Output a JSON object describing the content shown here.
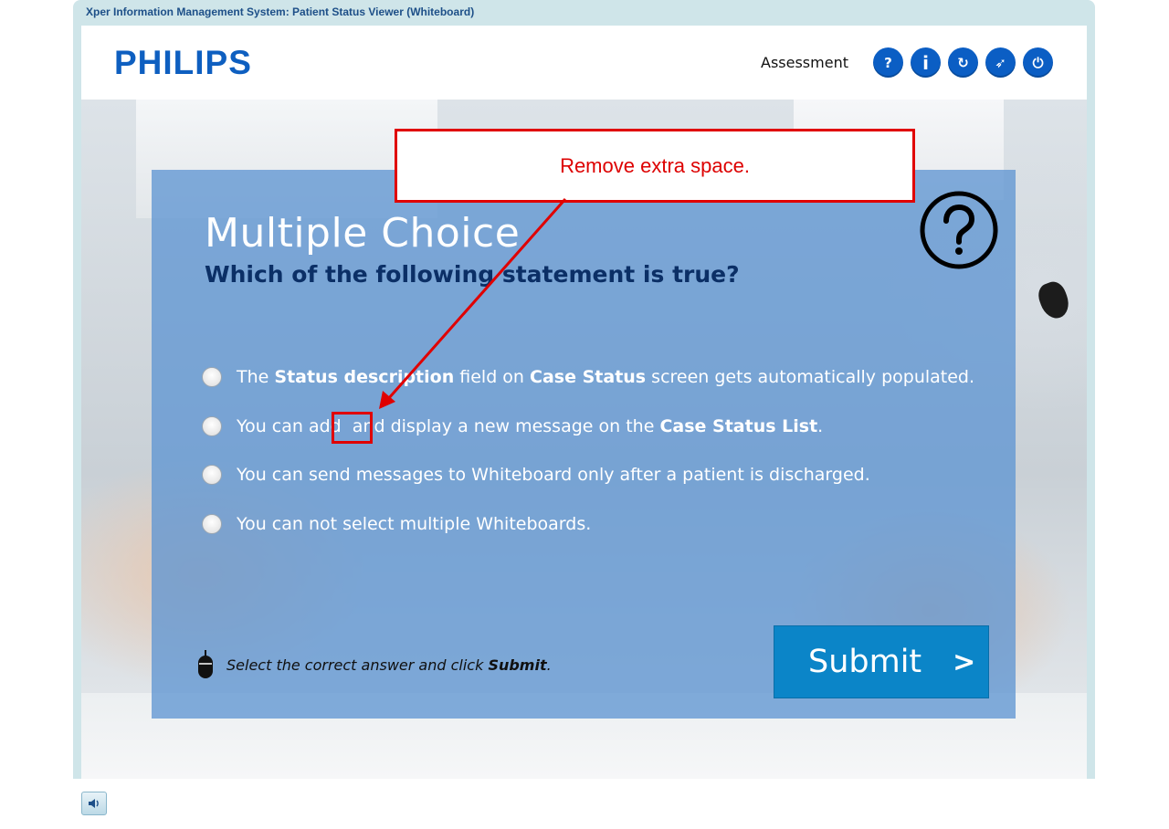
{
  "window": {
    "title": "Xper Information Management System: Patient Status Viewer (Whiteboard)"
  },
  "header": {
    "logo_text": "PHILIPS",
    "section_label": "Assessment",
    "buttons": [
      {
        "name": "help-button",
        "glyph": "?"
      },
      {
        "name": "info-button",
        "glyph": "i"
      },
      {
        "name": "replay-button",
        "glyph": "↻"
      },
      {
        "name": "navigate-button",
        "glyph": "➶"
      },
      {
        "name": "exit-button",
        "glyph": "⏻"
      }
    ]
  },
  "question": {
    "title": "Multiple Choice",
    "prompt": "Which of the following statement is true?",
    "options": [
      {
        "parts": [
          {
            "t": "The "
          },
          {
            "t": "Status description",
            "b": true
          },
          {
            "t": " field on "
          },
          {
            "t": "Case Status",
            "b": true
          },
          {
            "t": " screen gets automatically populated."
          }
        ]
      },
      {
        "parts": [
          {
            "t": "You can add  and display a new message on the "
          },
          {
            "t": "Case Status List",
            "b": true
          },
          {
            "t": "."
          }
        ]
      },
      {
        "parts": [
          {
            "t": "You can send messages to Whiteboard only after a patient is discharged."
          }
        ]
      },
      {
        "parts": [
          {
            "t": "You can not select multiple Whiteboards."
          }
        ]
      }
    ],
    "instruction_prefix": "Select the correct answer and click ",
    "instruction_bold": "Submit",
    "instruction_suffix": ".",
    "submit_label": "Submit",
    "submit_chevron": ">"
  },
  "annotation": {
    "callout_text": "Remove extra space."
  },
  "colors": {
    "accent": "#0b5ec4",
    "panel": "#6096d2",
    "submit": "#0b85c8",
    "annotation": "#e00000",
    "prompt": "#0b2f66"
  },
  "icons": [
    "help-circle-icon",
    "mouse-icon",
    "speaker-icon"
  ]
}
